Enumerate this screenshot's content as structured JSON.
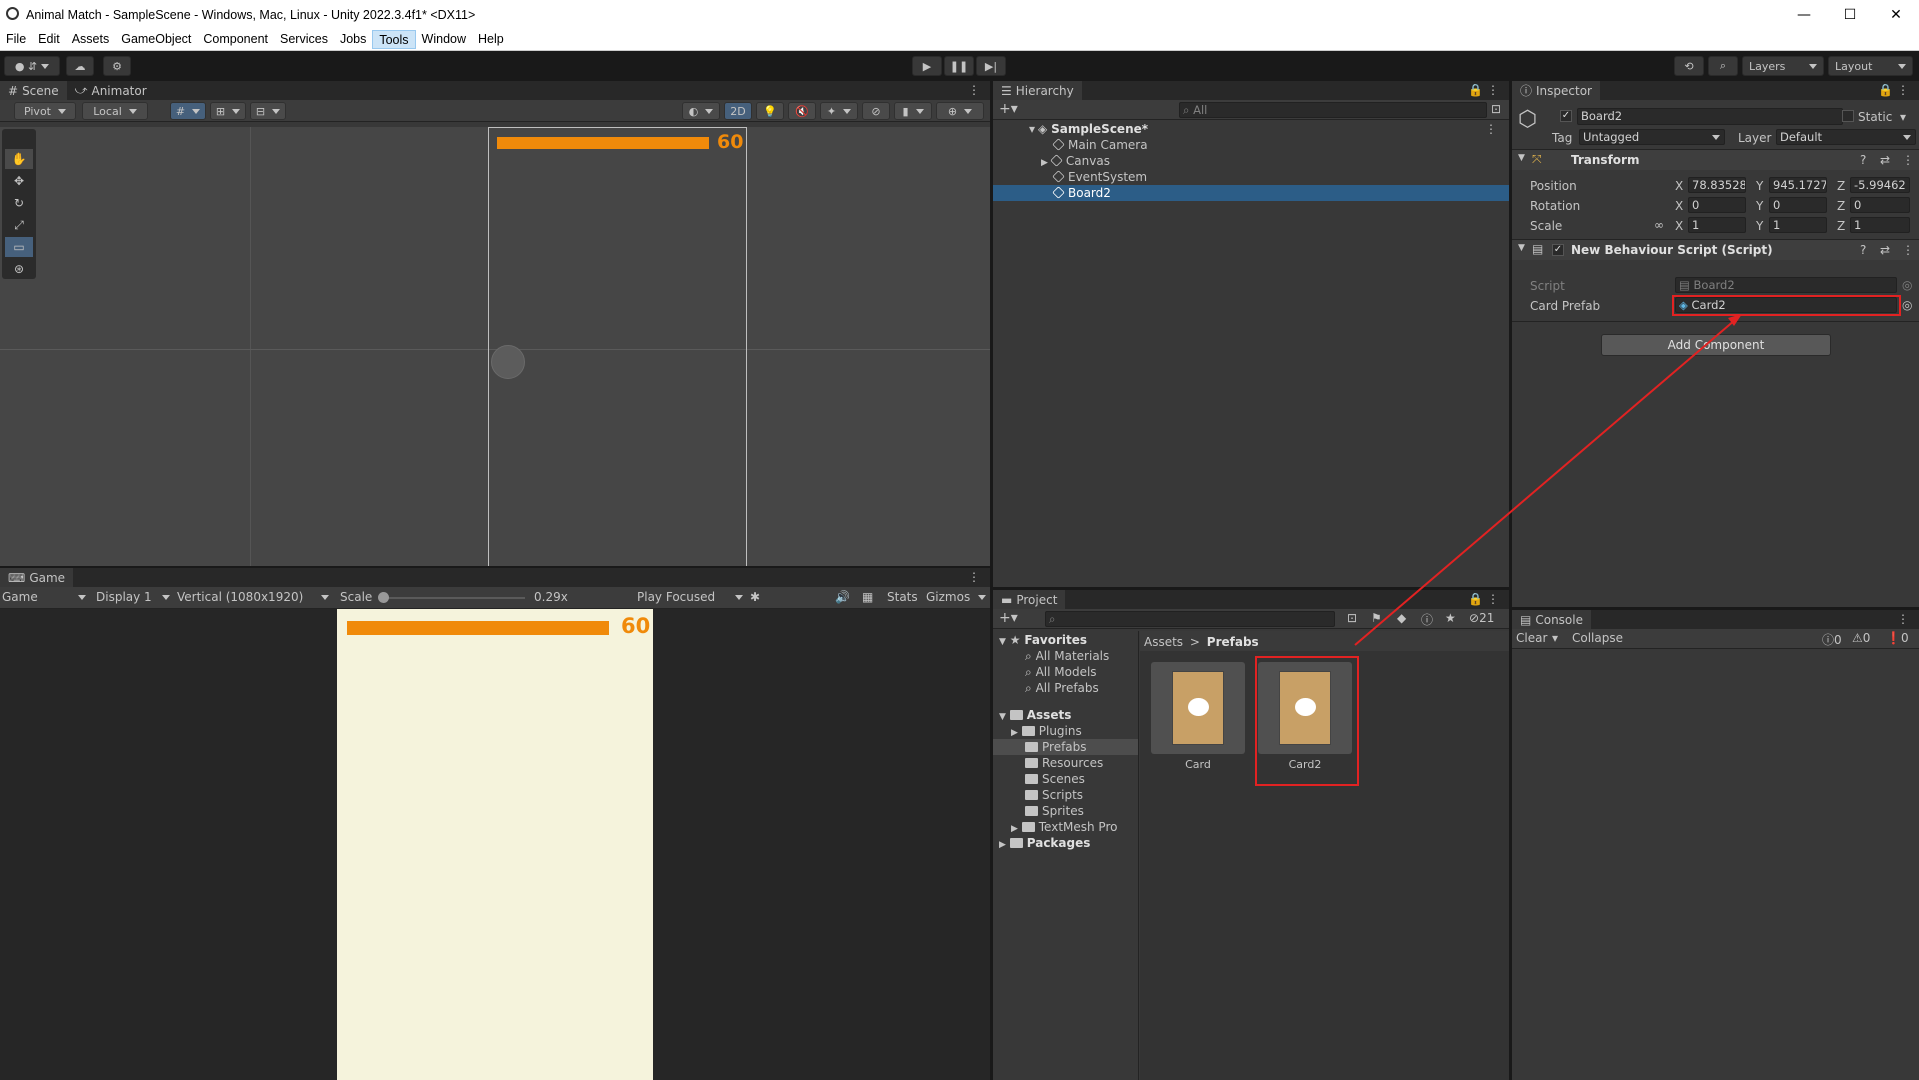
{
  "window": {
    "title": "Animal Match - SampleScene - Windows, Mac, Linux - Unity 2022.3.4f1* <DX11>",
    "controls": [
      "—",
      "☐",
      "✕"
    ]
  },
  "menu": [
    "File",
    "Edit",
    "Assets",
    "GameObject",
    "Component",
    "Services",
    "Jobs",
    "Tools",
    "Window",
    "Help"
  ],
  "menu_active": "Tools",
  "toolbar": {
    "layers_label": "Layers",
    "layout_label": "Layout"
  },
  "scene": {
    "tabs": [
      "Scene",
      "Animator"
    ],
    "pivot_label": "Pivot",
    "local_label": "Local",
    "mode_2d": "2D",
    "score_value": "60",
    "timer_fill_fraction": 0.98
  },
  "game": {
    "tab": "Game",
    "mode_label": "Game",
    "display_label": "Display 1",
    "resolution_label": "Vertical (1080x1920)",
    "scale_label": "Scale",
    "scale_value": "0.29x",
    "play_focused_label": "Play Focused",
    "stats_label": "Stats",
    "gizmos_label": "Gizmos",
    "score_value": "60",
    "background_color": "#f5f3dc",
    "bar_color": "#f08a0a"
  },
  "hierarchy": {
    "tab": "Hierarchy",
    "search_placeholder": "All",
    "scene_name": "SampleScene*",
    "items": [
      "Main Camera",
      "Canvas",
      "EventSystem",
      "Board2"
    ],
    "selected": "Board2"
  },
  "inspector": {
    "tab": "Inspector",
    "object_name": "Board2",
    "static_label": "Static",
    "tag_label": "Tag",
    "tag_value": "Untagged",
    "layer_label": "Layer",
    "layer_value": "Default",
    "transform": {
      "header": "Transform",
      "position_label": "Position",
      "rotation_label": "Rotation",
      "scale_label": "Scale",
      "position": {
        "x": "78.83528",
        "y": "945.1727",
        "z": "-5.99462"
      },
      "rotation": {
        "x": "0",
        "y": "0",
        "z": "0"
      },
      "scale": {
        "x": "1",
        "y": "1",
        "z": "1"
      },
      "axis_x": "X",
      "axis_y": "Y",
      "axis_z": "Z"
    },
    "script_component": {
      "header": "New Behaviour Script (Script)",
      "script_label": "Script",
      "script_value": "Board2",
      "card_prefab_label": "Card Prefab",
      "card_prefab_value": "Card2"
    },
    "add_component_label": "Add Component"
  },
  "project": {
    "tab": "Project",
    "hidden_count": "21",
    "favorites_label": "Favorites",
    "favorites": [
      "All Materials",
      "All Models",
      "All Prefabs"
    ],
    "assets_label": "Assets",
    "asset_folders": [
      "Plugins",
      "Prefabs",
      "Resources",
      "Scenes",
      "Scripts",
      "Sprites",
      "TextMesh Pro"
    ],
    "packages_label": "Packages",
    "breadcrumb": [
      "Assets",
      "Prefabs"
    ],
    "breadcrumb_sep": ">",
    "prefabs": [
      "Card",
      "Card2"
    ]
  },
  "console": {
    "tab": "Console",
    "clear_label": "Clear",
    "collapse_label": "Collapse",
    "log_count": "0",
    "warn_count": "0",
    "error_count": "0"
  },
  "annotation": {
    "color": "#e22222"
  }
}
